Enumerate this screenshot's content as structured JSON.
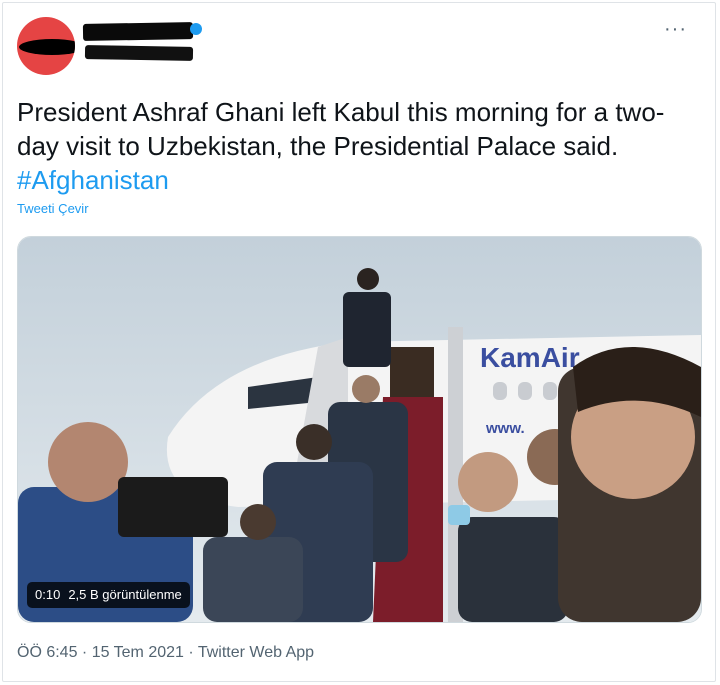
{
  "tweet": {
    "text_main": "President Ashraf Ghani left Kabul this morning for a two-day visit to Uzbekistan, the Presidential Palace said. ",
    "hashtag": "#Afghanistan",
    "translate_label": "Tweeti Çevir"
  },
  "media": {
    "plane_livery": "KamAir",
    "plane_url": "www.",
    "duration": "0:10",
    "views": "2,5 B görüntülenme"
  },
  "footer": {
    "time": "ÖÖ 6:45",
    "date": "15 Tem 2021",
    "source": "Twitter Web App",
    "sep": " · "
  },
  "more_label": "···",
  "colors": {
    "link": "#1d9bf0",
    "text": "#0f1419",
    "meta": "#536471"
  }
}
